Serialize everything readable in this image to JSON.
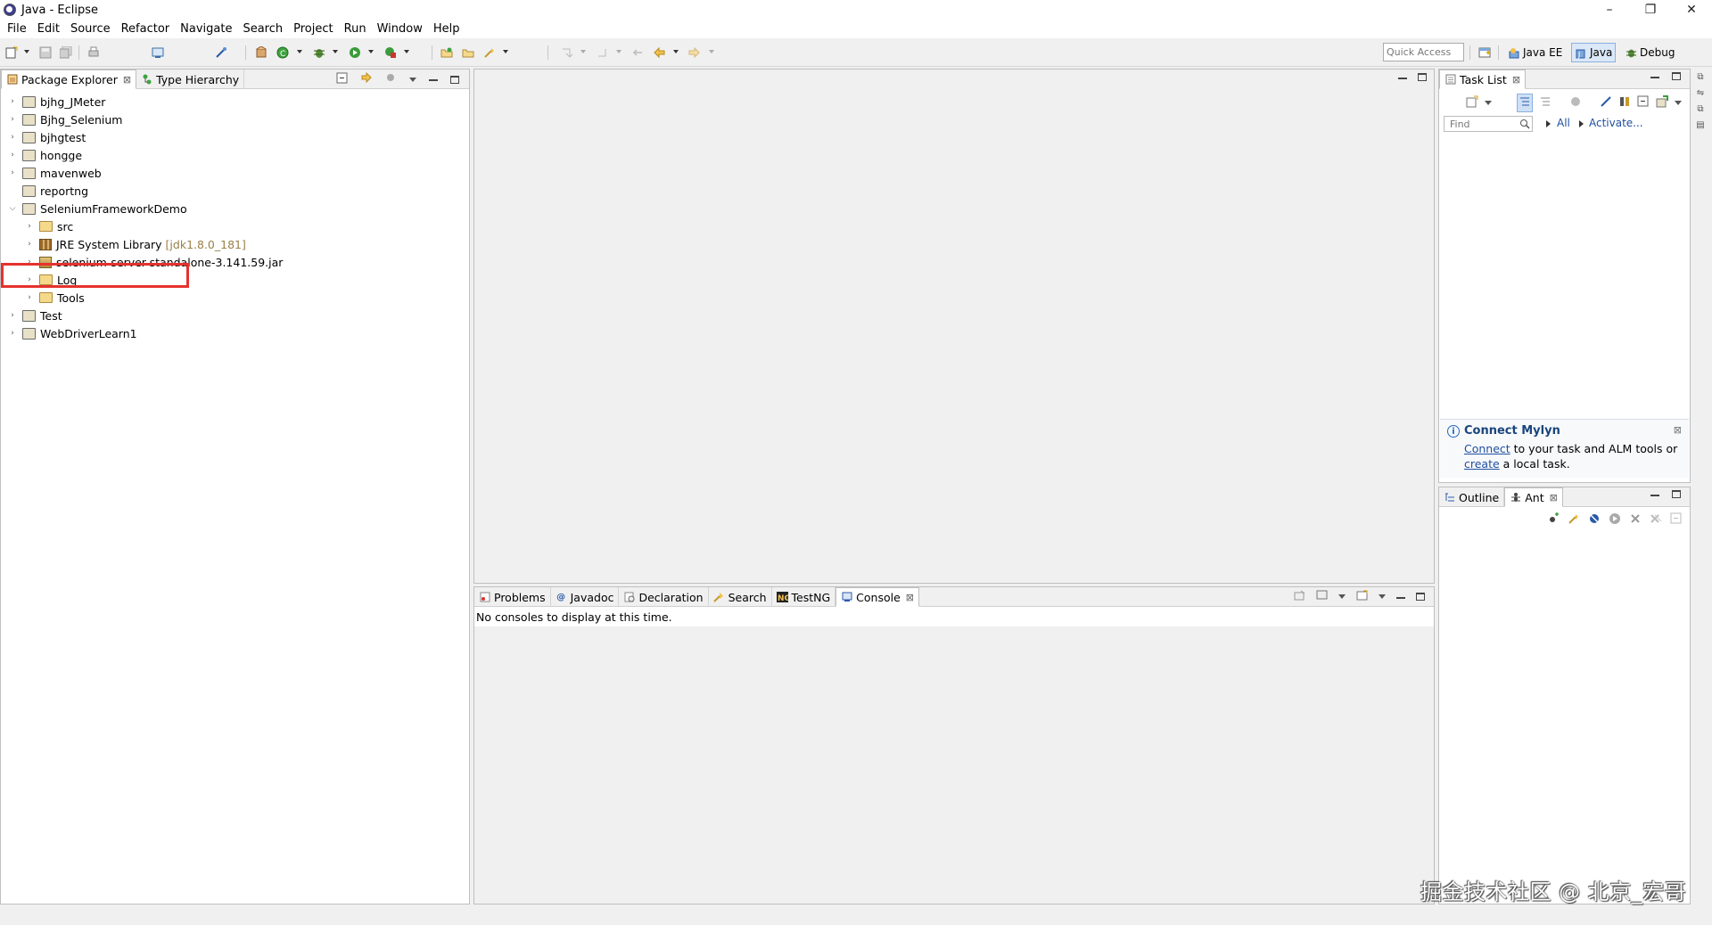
{
  "window": {
    "title": "Java - Eclipse",
    "controls": [
      "–",
      "❐",
      "✕"
    ]
  },
  "menu": [
    "File",
    "Edit",
    "Source",
    "Refactor",
    "Navigate",
    "Search",
    "Project",
    "Run",
    "Window",
    "Help"
  ],
  "toolbar": {
    "quick_access_placeholder": "Quick Access",
    "perspectives": [
      {
        "label": "Java EE",
        "active": false
      },
      {
        "label": "Java",
        "active": true
      },
      {
        "label": "Debug",
        "active": false
      }
    ]
  },
  "package_explorer": {
    "tabs": [
      {
        "label": "Package Explorer",
        "active": true
      },
      {
        "label": "Type Hierarchy",
        "active": false
      }
    ],
    "tree": [
      {
        "label": "bjhg_JMeter",
        "level": 0,
        "expanded": false
      },
      {
        "label": "Bjhg_Selenium",
        "level": 0,
        "expanded": false
      },
      {
        "label": "bjhgtest",
        "level": 0,
        "expanded": false
      },
      {
        "label": "hongge",
        "level": 0,
        "expanded": false
      },
      {
        "label": "mavenweb",
        "level": 0,
        "expanded": false
      },
      {
        "label": "reportng",
        "level": 0,
        "expanded": null
      },
      {
        "label": "SeleniumFrameworkDemo",
        "level": 0,
        "expanded": true,
        "highlighted": true
      },
      {
        "label": "src",
        "level": 1,
        "expanded": false
      },
      {
        "label": "JRE System Library",
        "decoration": "[jdk1.8.0_181]",
        "level": 1,
        "expanded": false
      },
      {
        "label": "selenium-server-standalone-3.141.59.jar",
        "level": 1,
        "expanded": false
      },
      {
        "label": "Log",
        "level": 1,
        "expanded": false
      },
      {
        "label": "Tools",
        "level": 1,
        "expanded": false
      },
      {
        "label": "Test",
        "level": 0,
        "expanded": false
      },
      {
        "label": "WebDriverLearn1",
        "level": 0,
        "expanded": false
      }
    ]
  },
  "bottom_panel": {
    "tabs": [
      {
        "label": "Problems",
        "active": false
      },
      {
        "label": "Javadoc",
        "active": false
      },
      {
        "label": "Declaration",
        "active": false
      },
      {
        "label": "Search",
        "active": false
      },
      {
        "label": "TestNG",
        "active": false
      },
      {
        "label": "Console",
        "active": true
      }
    ],
    "console_message": "No consoles to display at this time."
  },
  "task_list": {
    "tab_label": "Task List",
    "find_placeholder": "Find",
    "filter_all": "All",
    "activate": "Activate...",
    "mylyn": {
      "title": "Connect Mylyn",
      "connect_link": "Connect",
      "text1": " to your task and ALM tools or",
      "create_link": "create",
      "text2": " a local task."
    }
  },
  "outline_panel": {
    "tabs": [
      {
        "label": "Outline",
        "active": false
      },
      {
        "label": "Ant",
        "active": true
      }
    ]
  },
  "watermark": "掘金技术社区 @ 北京_宏哥"
}
